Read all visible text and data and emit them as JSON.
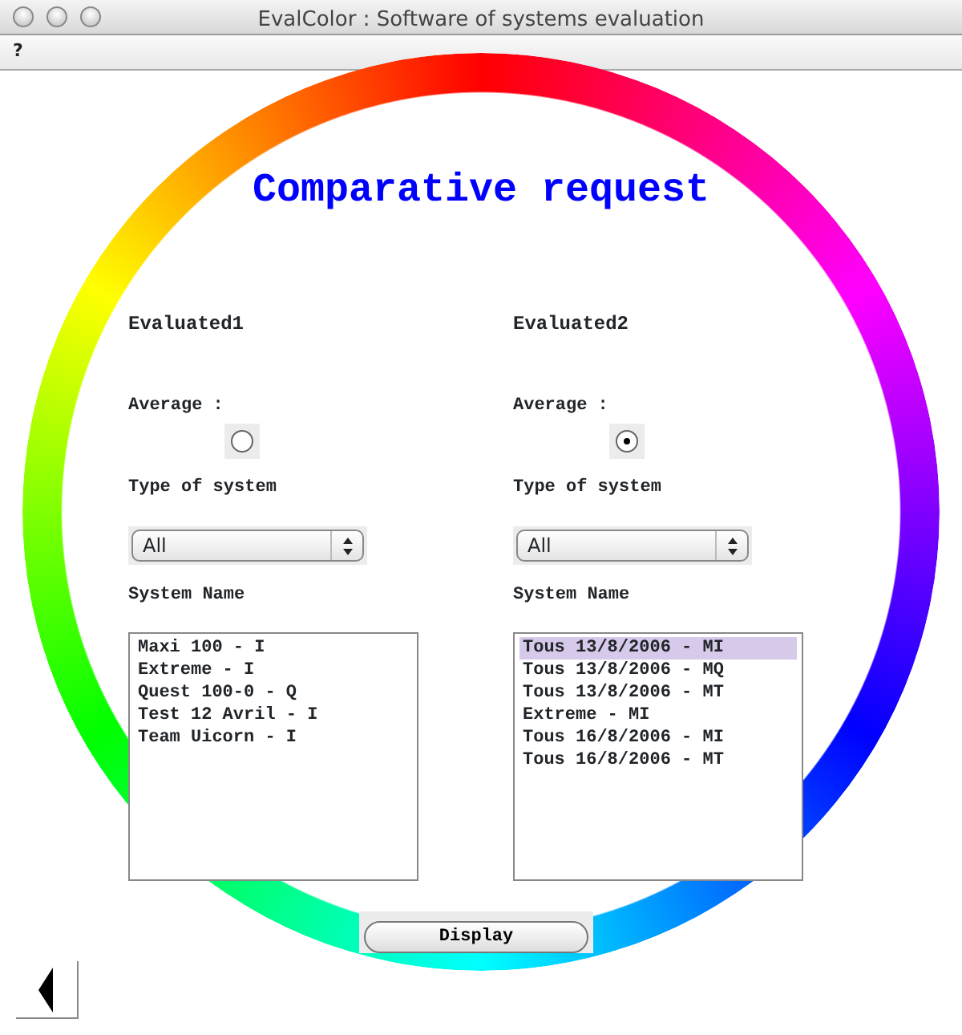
{
  "window": {
    "title": "EvalColor : Software of systems evaluation"
  },
  "menu": [
    "?"
  ],
  "title": "Comparative request",
  "panels": [
    {
      "heading": "Evaluated1",
      "average_label": "Average :",
      "average_selected": false,
      "type_label": "Type of system",
      "type_value": "All",
      "name_label": "System Name",
      "systems": [
        {
          "label": "Maxi 100 - I",
          "selected": false
        },
        {
          "label": "Extreme - I",
          "selected": false
        },
        {
          "label": "Quest 100-0 - Q",
          "selected": false
        },
        {
          "label": "Test 12 Avril - I",
          "selected": false
        },
        {
          "label": "Team Uicorn - I",
          "selected": false
        }
      ]
    },
    {
      "heading": "Evaluated2",
      "average_label": "Average :",
      "average_selected": true,
      "type_label": "Type of system",
      "type_value": "All",
      "name_label": "System Name",
      "systems": [
        {
          "label": "Tous 13/8/2006 - MI",
          "selected": true
        },
        {
          "label": "Tous 13/8/2006 - MQ",
          "selected": false
        },
        {
          "label": "Tous 13/8/2006 - MT",
          "selected": false
        },
        {
          "label": "Extreme - MI",
          "selected": false
        },
        {
          "label": "Tous 16/8/2006 - MI",
          "selected": false
        },
        {
          "label": "Tous 16/8/2006 - MT",
          "selected": false
        }
      ]
    }
  ],
  "display_button": "Display"
}
